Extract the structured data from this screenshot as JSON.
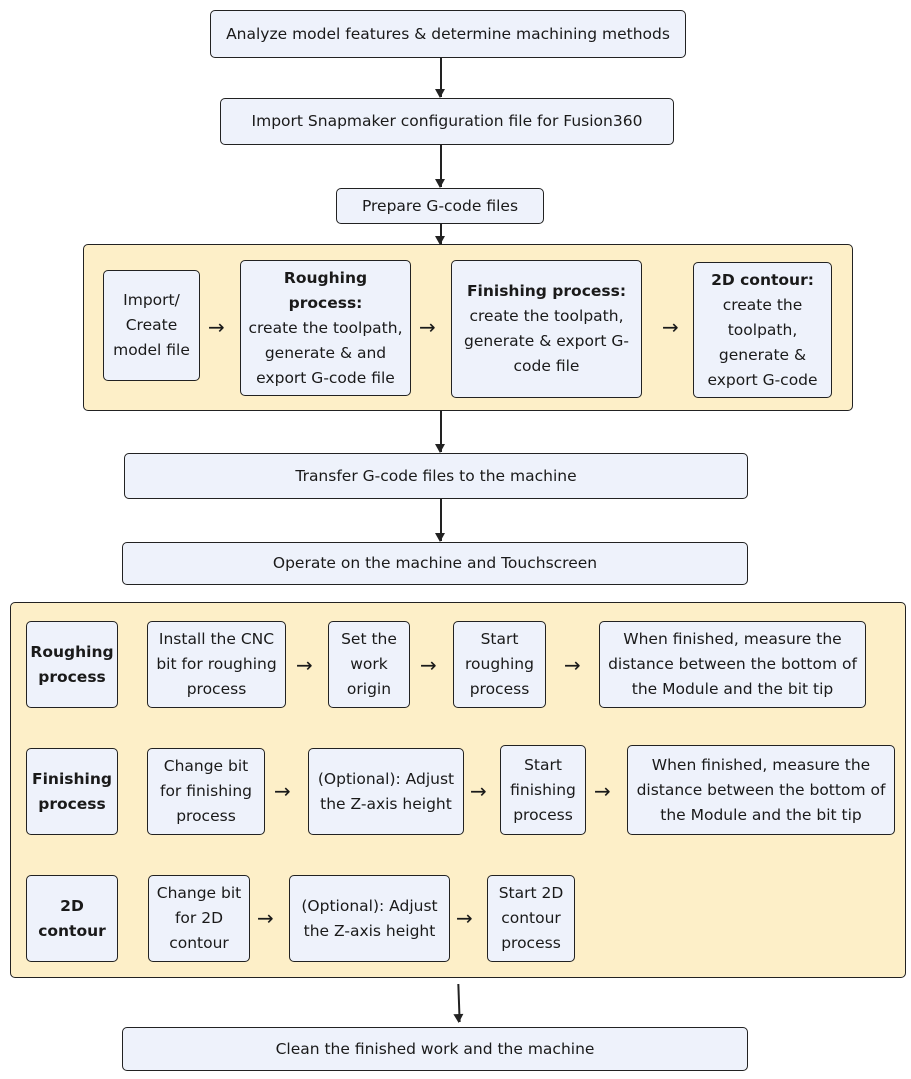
{
  "steps": {
    "analyze": "Analyze model features & determine machining methods",
    "import_config": "Import Snapmaker configuration file for Fusion360",
    "prepare": "Prepare G-code files",
    "transfer": "Transfer G-code files to the machine",
    "operate": "Operate on the machine and Touchscreen",
    "clean": "Clean the finished work and the machine"
  },
  "prepare_group": {
    "import_model": "Import/ Create model file",
    "roughing_title": "Roughing process:",
    "roughing_text": "create the toolpath, generate & and export G-code file",
    "finishing_title": "Finishing process:",
    "finishing_text": "create the toolpath, generate &  export G-code file",
    "contour_title": "2D contour:",
    "contour_text": "create the toolpath, generate & export G-code"
  },
  "operate_group": {
    "roughing": {
      "label": "Roughing process",
      "steps": [
        "Install the CNC bit for roughing process",
        "Set the work origin",
        "Start roughing process",
        "When finished, measure the distance between the bottom of the Module and the bit tip"
      ]
    },
    "finishing": {
      "label": "Finishing process",
      "steps": [
        "Change bit for finishing process",
        "(Optional): Adjust the Z-axis height",
        "Start finishing process",
        "When finished, measure the distance between the bottom of the Module and the bit tip"
      ]
    },
    "contour": {
      "label": "2D contour",
      "steps": [
        "Change bit for 2D contour",
        "(Optional): Adjust the Z-axis height",
        "Start 2D contour process"
      ]
    }
  },
  "arrow": "→",
  "colors": {
    "box": "#eef2fb",
    "group": "#fdefc8",
    "stroke": "#222222"
  }
}
